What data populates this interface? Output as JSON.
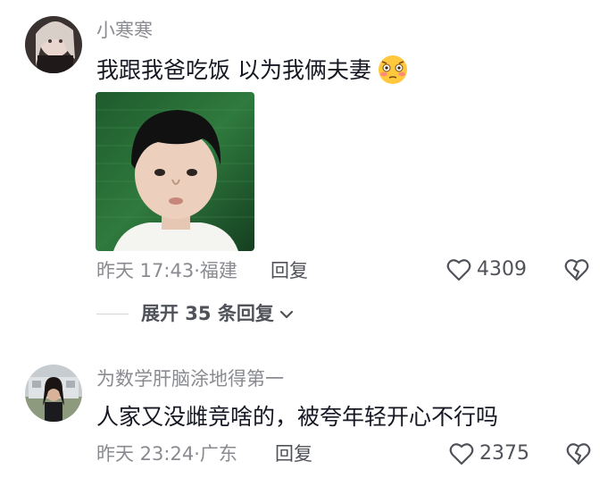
{
  "comments": [
    {
      "username": "小寒寒",
      "text": "我跟我爸吃饭 以为我俩夫妻",
      "emoji": "flushed-face-emoji",
      "has_photo": true,
      "time": "昨天 17:43",
      "location": "福建",
      "reply_label": "回复",
      "likes": "4309"
    },
    {
      "username": "为数学肝脑涂地得第一",
      "text": "人家又没雌竞啥的，被夸年轻开心不行吗",
      "time": "昨天 23:24",
      "location": "广东",
      "reply_label": "回复",
      "likes": "2375"
    }
  ],
  "expand_replies": {
    "label": "展开 35 条回复"
  },
  "icons": {
    "like": "heart-outline-icon",
    "dislike": "broken-heart-icon",
    "expand": "chevron-down-icon"
  },
  "colors": {
    "primary_text": "#161823",
    "secondary_text": "#8a8b91",
    "action_text": "#505259"
  }
}
